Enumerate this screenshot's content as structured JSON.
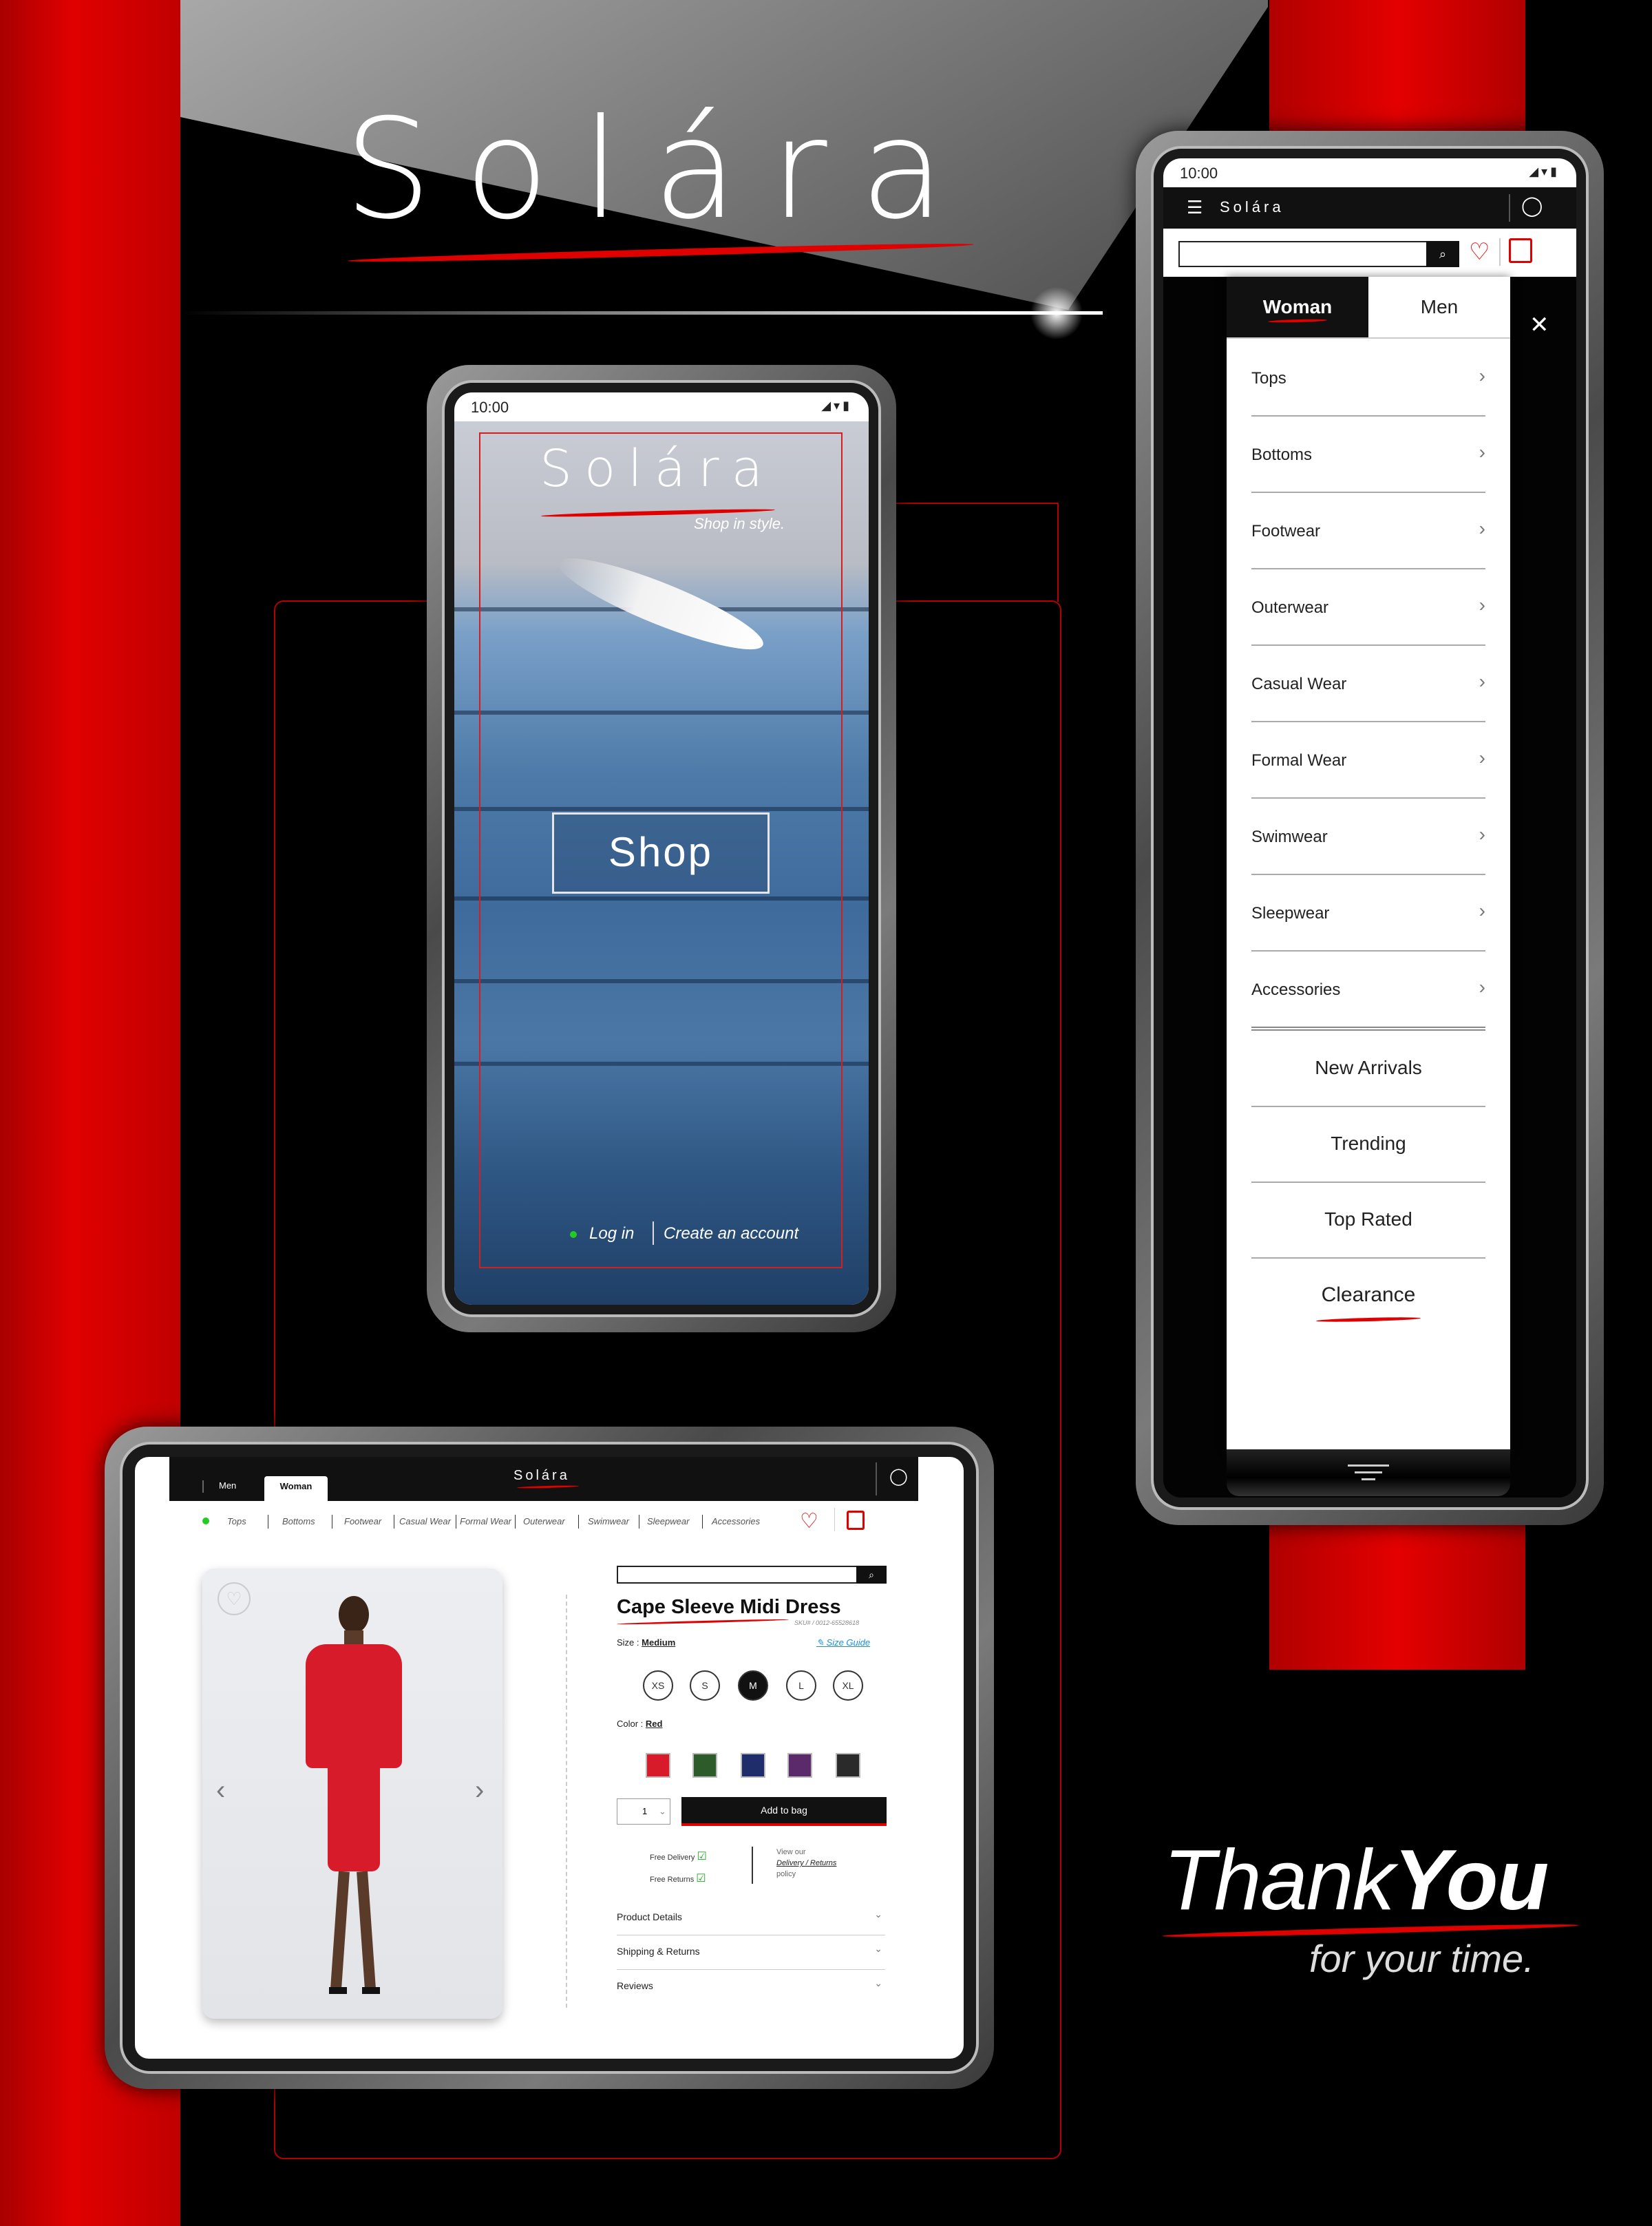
{
  "brand": {
    "name": "Solára",
    "tagline": "Shop in style."
  },
  "colors": {
    "accent": "#e00000",
    "dark": "#111111",
    "link": "#1a8fd8"
  },
  "phone_splash": {
    "time": "10:00",
    "shop_label": "Shop",
    "login_label": "Log in",
    "create_account_label": "Create an account"
  },
  "phone_menu": {
    "time": "10:00",
    "tabs": [
      "Woman",
      "Men"
    ],
    "active_tab": "Woman",
    "categories": [
      "Tops",
      "Bottoms",
      "Footwear",
      "Outerwear",
      "Casual Wear",
      "Formal Wear",
      "Swimwear",
      "Sleepwear",
      "Accessories"
    ],
    "featured": [
      "New Arrivals",
      "Trending",
      "Top Rated",
      "Clearance"
    ]
  },
  "tablet": {
    "tabs": [
      "Men",
      "Woman"
    ],
    "active_tab": "Woman",
    "nav_items": [
      "Tops",
      "Bottoms",
      "Footwear",
      "Casual Wear",
      "Formal Wear",
      "Outerwear",
      "Swimwear",
      "Sleepwear",
      "Accessories"
    ],
    "product": {
      "title": "Cape Sleeve Midi Dress",
      "sku": "SKU# / 0012-65528618",
      "size_label": "Size :",
      "size_value": "Medium",
      "size_guide": "Size Guide",
      "sizes": [
        "XS",
        "S",
        "M",
        "L",
        "XL"
      ],
      "selected_size": "M",
      "color_label": "Color :",
      "color_value": "Red",
      "swatches": [
        "#d81b2a",
        "#2e5b2a",
        "#1f2d6b",
        "#5a2a6a",
        "#2a2a2a"
      ],
      "quantity": "1",
      "add_to_bag": "Add to bag",
      "free_delivery": "Free Delivery",
      "free_returns": "Free Returns",
      "policy_prefix": "View our",
      "policy_link": "Delivery / Returns",
      "policy_suffix": "policy",
      "accordion": [
        "Product Details",
        "Shipping & Returns",
        "Reviews"
      ]
    }
  },
  "thank_you": {
    "thank": "Thank",
    "you": "You",
    "sub": "for your time."
  }
}
